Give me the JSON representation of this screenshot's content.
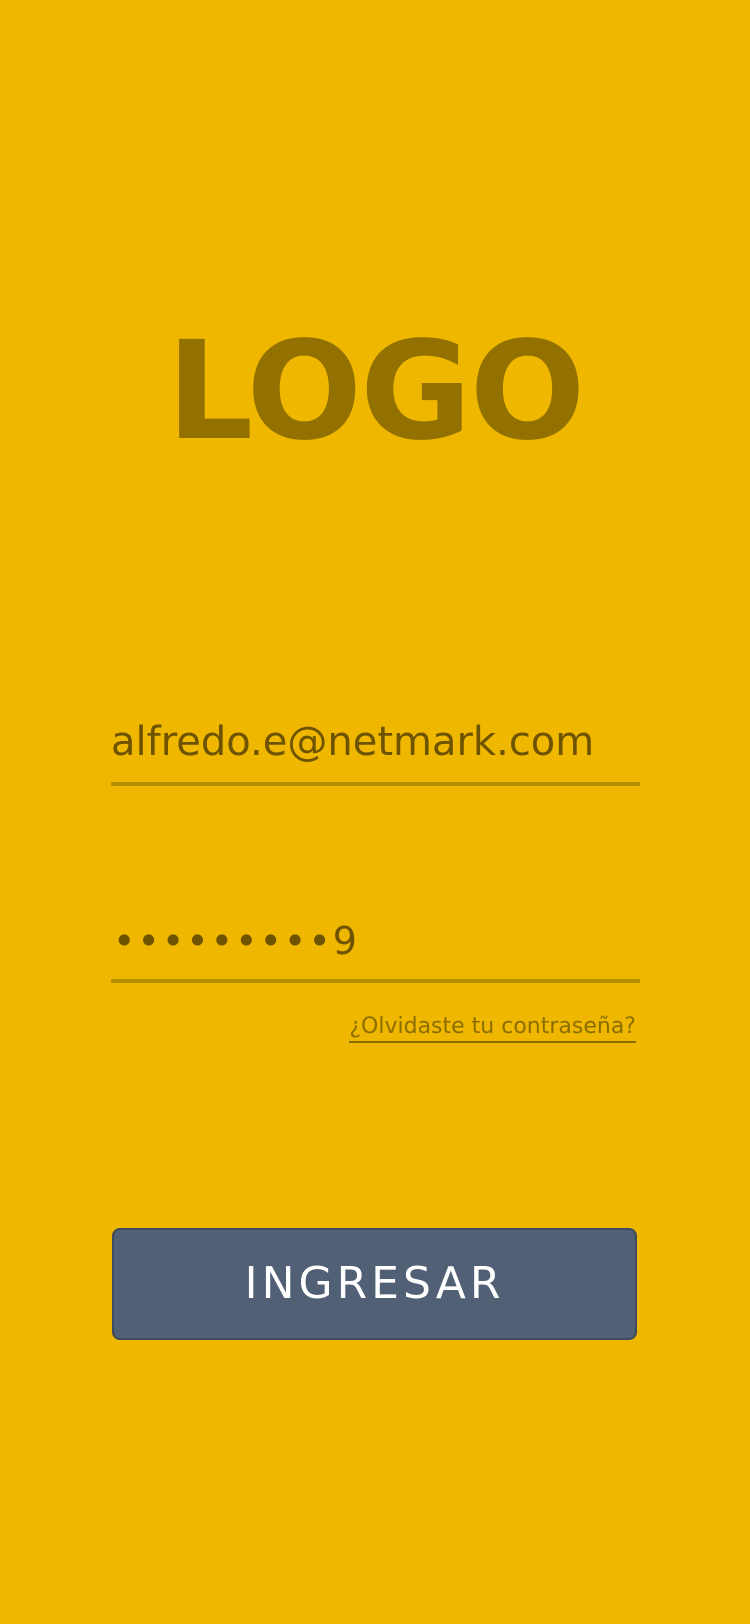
{
  "logo": {
    "text": "LOGO"
  },
  "email": {
    "value": "alfredo.e@netmark.com"
  },
  "password": {
    "masked_value": "•••••••••9"
  },
  "forgot_password": {
    "label": "¿Olvidaste tu contraseña?"
  },
  "login_button": {
    "label": "INGRESAR"
  },
  "colors": {
    "background": "#EFB700",
    "logo": "#927100",
    "input_text": "#6E5300",
    "underline": "#B58D00",
    "button_bg": "#516075",
    "button_text": "#FFFFFF"
  }
}
